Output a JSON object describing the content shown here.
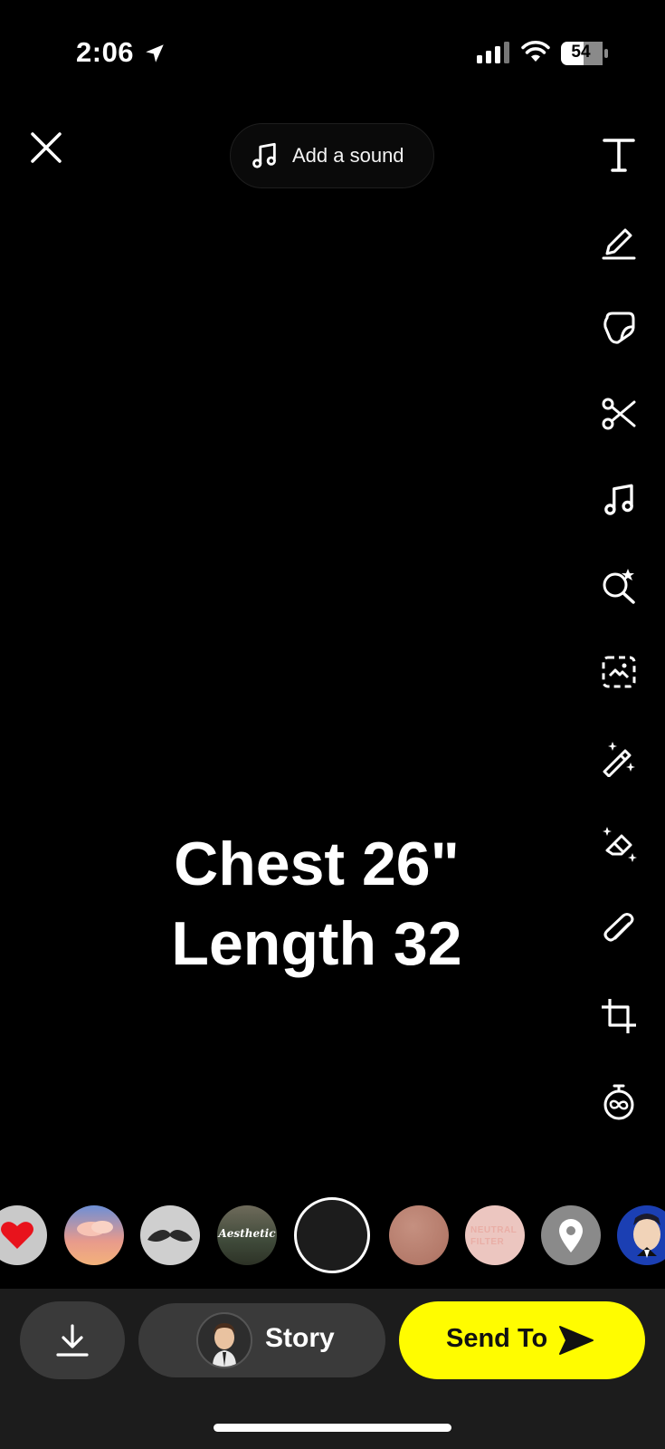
{
  "status_bar": {
    "time": "2:06",
    "battery_level": "54"
  },
  "sound": {
    "label": "Add a sound"
  },
  "caption": {
    "line1": "Chest 26\"",
    "line2": "Length 32"
  },
  "toolbar": {
    "icons": [
      "text-icon",
      "pencil-icon",
      "sticker-icon",
      "scissors-icon",
      "music-icon",
      "lens-search-icon",
      "scan-icon",
      "magic-wand-icon",
      "eraser-icon",
      "paperclip-icon",
      "crop-icon",
      "timer-icon"
    ]
  },
  "lenses": {
    "items": [
      "heart",
      "sunset-clouds",
      "mustache",
      "aesthetic",
      "current",
      "skin-tone",
      "neutral-filter",
      "location",
      "avatar-face"
    ],
    "aesthetic_text": "Aesthetic",
    "neutral_text_1": "NEUTRAL",
    "neutral_text_2": "FILTER"
  },
  "bottom": {
    "story_label": "Story",
    "send_label": "Send To"
  },
  "colors": {
    "send_button": "#fffc00",
    "bottom_bar": "#1c1c1c",
    "pill": "#3a3a3a"
  }
}
